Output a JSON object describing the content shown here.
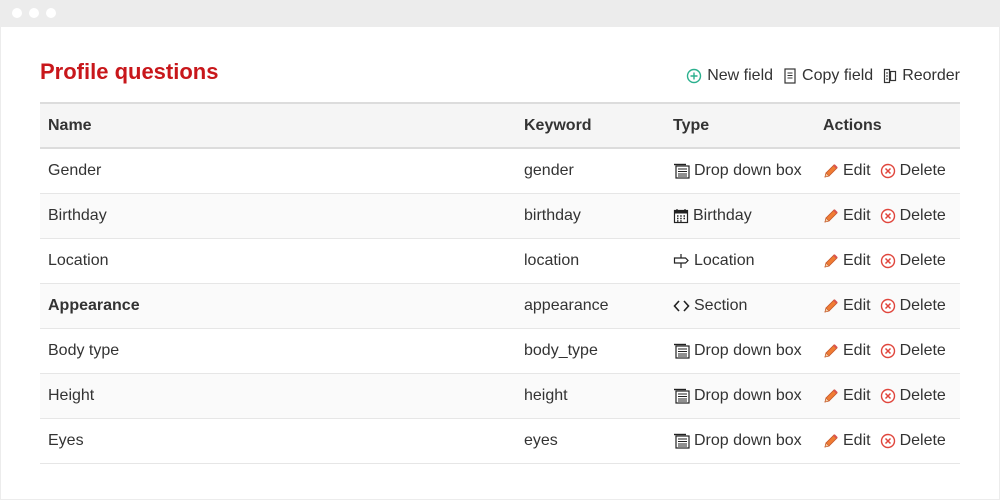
{
  "page": {
    "title": "Profile questions"
  },
  "toolbar": {
    "new_field": "New field",
    "copy_field": "Copy field",
    "reorder": "Reorder"
  },
  "table": {
    "headers": {
      "name": "Name",
      "keyword": "Keyword",
      "type": "Type",
      "actions": "Actions"
    },
    "rows": [
      {
        "name": "Gender",
        "keyword": "gender",
        "type": "Drop down box",
        "type_icon": "dropdown-icon",
        "bold": false
      },
      {
        "name": "Birthday",
        "keyword": "birthday",
        "type": "Birthday",
        "type_icon": "calendar-icon",
        "bold": false
      },
      {
        "name": "Location",
        "keyword": "location",
        "type": "Location",
        "type_icon": "signpost-icon",
        "bold": false
      },
      {
        "name": "Appearance",
        "keyword": "appearance",
        "type": "Section",
        "type_icon": "code-icon",
        "bold": true
      },
      {
        "name": "Body type",
        "keyword": "body_type",
        "type": "Drop down box",
        "type_icon": "dropdown-icon",
        "bold": false
      },
      {
        "name": "Height",
        "keyword": "height",
        "type": "Drop down box",
        "type_icon": "dropdown-icon",
        "bold": false
      },
      {
        "name": "Eyes",
        "keyword": "eyes",
        "type": "Drop down box",
        "type_icon": "dropdown-icon",
        "bold": false
      }
    ],
    "edit_label": "Edit",
    "delete_label": "Delete"
  },
  "colors": {
    "title": "#c8171b",
    "add_icon": "#2bb08e",
    "delete_icon": "#e0453c"
  }
}
